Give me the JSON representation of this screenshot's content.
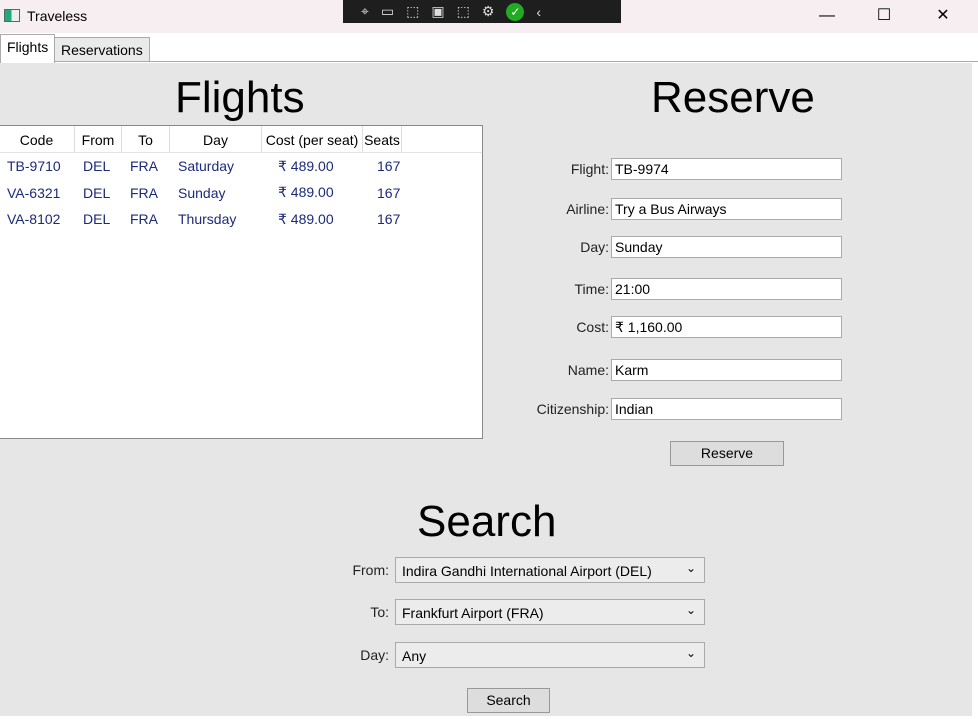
{
  "window": {
    "title": "Traveless",
    "minimize": "—",
    "maximize": "☐",
    "close": "✕"
  },
  "tabs": [
    {
      "label": "Flights"
    },
    {
      "label": "Reservations"
    }
  ],
  "flights": {
    "title": "Flights",
    "columns": [
      "Code",
      "From",
      "To",
      "Day",
      "Cost (per seat)",
      "Seats"
    ],
    "rows": [
      [
        "TB-9710",
        "DEL",
        "FRA",
        "Saturday",
        "₹ 489.00",
        "167"
      ],
      [
        "VA-6321",
        "DEL",
        "FRA",
        "Sunday",
        "₹ 489.00",
        "167"
      ],
      [
        "VA-8102",
        "DEL",
        "FRA",
        "Thursday",
        "₹ 489.00",
        "167"
      ]
    ]
  },
  "reserve": {
    "title": "Reserve",
    "fields": [
      {
        "label": "Flight:",
        "value": "TB-9974"
      },
      {
        "label": "Airline:",
        "value": "Try a Bus Airways"
      },
      {
        "label": "Day:",
        "value": "Sunday"
      },
      {
        "label": "Time:",
        "value": "21:00"
      },
      {
        "label": "Cost:",
        "value": "₹ 1,160.00"
      },
      {
        "label": "Name:",
        "value": "Karm"
      },
      {
        "label": "Citizenship:",
        "value": "Indian"
      }
    ],
    "button": "Reserve"
  },
  "search": {
    "title": "Search",
    "from_label": "From:",
    "from_value": "Indira Gandhi International Airport (DEL)",
    "to_label": "To:",
    "to_value": "Frankfurt Airport (FRA)",
    "day_label": "Day:",
    "day_value": "Any",
    "button": "Search"
  }
}
